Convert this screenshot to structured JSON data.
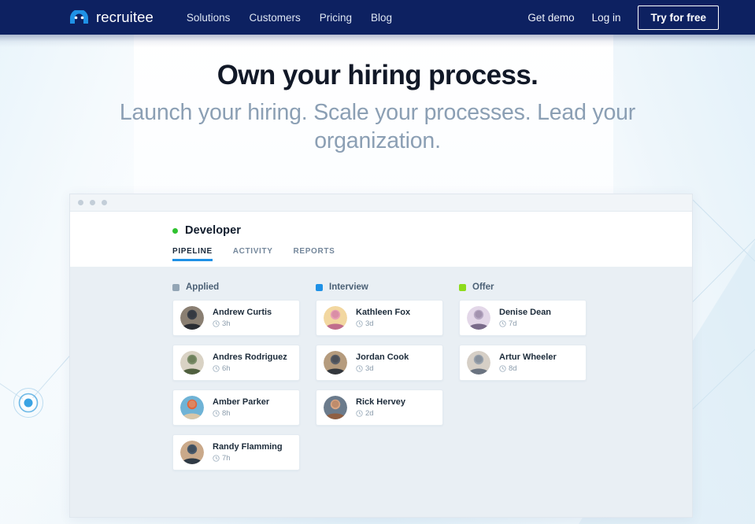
{
  "nav": {
    "brand": {
      "name": "recruitee",
      "icon": "recruitee-logo-icon"
    },
    "links": [
      {
        "label": "Solutions",
        "name": "solutions"
      },
      {
        "label": "Customers",
        "name": "customers"
      },
      {
        "label": "Pricing",
        "name": "pricing"
      },
      {
        "label": "Blog",
        "name": "blog"
      }
    ],
    "get_demo": "Get demo",
    "log_in": "Log in",
    "try_free": "Try for free",
    "bg_color": "#0d2161"
  },
  "hero": {
    "headline": "Own your hiring process.",
    "subheadline": "Launch your hiring. Scale your processes. Lead your organization."
  },
  "app": {
    "chrome_dots": 3,
    "job": {
      "title": "Developer",
      "status_color": "#2fc22f"
    },
    "tabs": [
      {
        "label": "PIPELINE",
        "active": true
      },
      {
        "label": "ACTIVITY",
        "active": false
      },
      {
        "label": "REPORTS",
        "active": false
      }
    ],
    "active_tab_color": "#1f91e6",
    "columns": [
      {
        "label": "Applied",
        "color": "#93a5b5",
        "cards": [
          {
            "name": "Andrew Curtis",
            "time": "3h",
            "avatar": "avatar-andrew-curtis"
          },
          {
            "name": "Andres Rodriguez",
            "time": "6h",
            "avatar": "avatar-andres-rodriguez"
          },
          {
            "name": "Amber Parker",
            "time": "8h",
            "avatar": "avatar-amber-parker"
          },
          {
            "name": "Randy Flamming",
            "time": "7h",
            "avatar": "avatar-randy-flamming"
          }
        ]
      },
      {
        "label": "Interview",
        "color": "#1f91e6",
        "cards": [
          {
            "name": "Kathleen Fox",
            "time": "3d",
            "avatar": "avatar-kathleen-fox"
          },
          {
            "name": "Jordan Cook",
            "time": "3d",
            "avatar": "avatar-jordan-cook"
          },
          {
            "name": "Rick Hervey",
            "time": "2d",
            "avatar": "avatar-rick-hervey"
          }
        ]
      },
      {
        "label": "Offer",
        "color": "#8ddb1b",
        "cards": [
          {
            "name": "Denise Dean",
            "time": "7d",
            "avatar": "avatar-denise-dean"
          },
          {
            "name": "Artur Wheeler",
            "time": "8d",
            "avatar": "avatar-artur-wheeler"
          }
        ]
      }
    ]
  },
  "decor": {
    "radar_dot": "radar-target-icon",
    "radar_color": "#3aa3e3"
  }
}
